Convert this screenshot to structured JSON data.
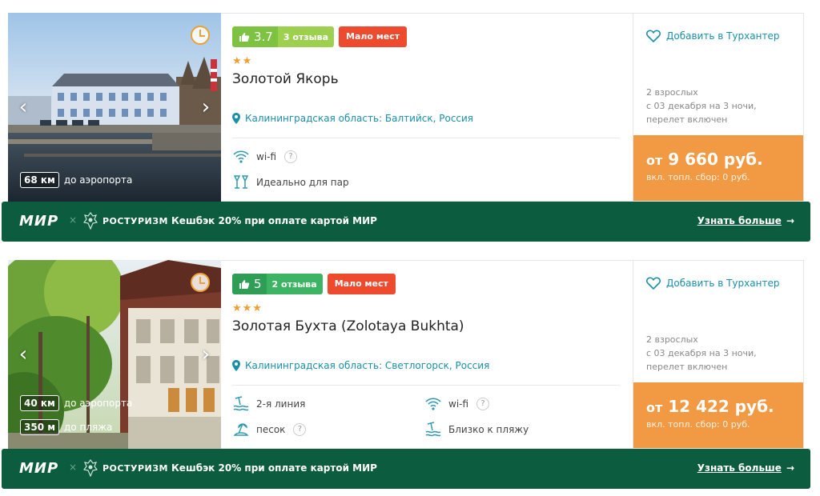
{
  "hotels": [
    {
      "rating": "3.7",
      "reviews": "3 отзыва",
      "badge": "Мало мест",
      "stars": "★★",
      "name": "Золотой Якорь",
      "location": "Калининградская область: Балтийск, Россия",
      "distances": [
        {
          "value": "68 км",
          "label": "до аэропорта"
        }
      ],
      "features": [
        {
          "icon": "wifi-icon",
          "label": "wi-fi",
          "help": "?"
        },
        {
          "icon": "couple-icon",
          "label": "Идеально для пар",
          "help": ""
        }
      ],
      "favorite": "Добавить в Турхантер",
      "tour": {
        "adults": "2 взрослых",
        "dates": "с 03 декабря на 3 ночи,",
        "flight": "перелет включен"
      },
      "price_from": "от",
      "price": "9 660 руб.",
      "price_note": "вкл. топл. сбор: 0 руб."
    },
    {
      "rating": "5",
      "reviews": "2 отзыва",
      "badge": "Мало мест",
      "stars": "★★★",
      "name": "Золотая Бухта (Zolotaya Bukhta)",
      "location": "Калининградская область: Светлогорск, Россия",
      "distances": [
        {
          "value": "40 км",
          "label": "до аэропорта"
        },
        {
          "value": "350 м",
          "label": "до пляжа"
        }
      ],
      "features": [
        {
          "icon": "beach-line-icon",
          "label": "2-я линия",
          "help": ""
        },
        {
          "icon": "wifi-icon",
          "label": "wi-fi",
          "help": "?"
        },
        {
          "icon": "sand-icon",
          "label": "песок",
          "help": "?"
        },
        {
          "icon": "beach-near-icon",
          "label": "Близко к пляжу",
          "help": ""
        }
      ],
      "favorite": "Добавить в Турхантер",
      "tour": {
        "adults": "2 взрослых",
        "dates": "с 03 декабря на 3 ночи,",
        "flight": "перелет включен"
      },
      "price_from": "от",
      "price": "12 422 руб.",
      "price_note": "вкл. топл. сбор: 0 руб."
    }
  ],
  "promo": {
    "mir": "МИР",
    "x": "×",
    "rostourism": "РОСТУРИЗМ",
    "cashback": "Кешбэк 20% при оплате картой МИР",
    "more": "Узнать больше",
    "arrow": "→"
  },
  "colors": {
    "accent": "#1a8fa8",
    "price_bg": "#f29944",
    "promo_bg": "#0c5d3f",
    "badge_red": "#ee4a2e",
    "rating_green": "#7ec242"
  }
}
